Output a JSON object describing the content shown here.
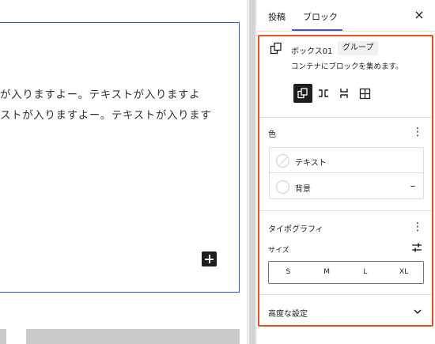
{
  "canvas": {
    "text_line_1": "が入りますよー。テキストが入りますよ",
    "text_line_2": "ストが入りますよー。テキストが入ります"
  },
  "sidebar": {
    "tabs": [
      {
        "label": "投稿",
        "active": false
      },
      {
        "label": "ブロック",
        "active": true
      }
    ],
    "close_label": "×",
    "block_card": {
      "name": "ボックス01",
      "variation": "グループ",
      "description": "コンテナにブロックを集めます。",
      "variations": [
        "group-icon",
        "row-icon",
        "stack-icon",
        "grid-icon"
      ]
    },
    "color_panel": {
      "title": "色",
      "items": [
        {
          "label": "テキスト",
          "swatch": "none"
        },
        {
          "label": "背景",
          "swatch": "none",
          "reset": "–"
        }
      ]
    },
    "typography_panel": {
      "title": "タイポグラフィ",
      "size_label": "サイズ",
      "sizes": [
        "S",
        "M",
        "L",
        "XL"
      ]
    },
    "advanced_panel": {
      "title": "高度な設定"
    }
  },
  "colors": {
    "highlight": "#e8521f",
    "accent": "#3858e9",
    "text": "#1e1e1e"
  }
}
